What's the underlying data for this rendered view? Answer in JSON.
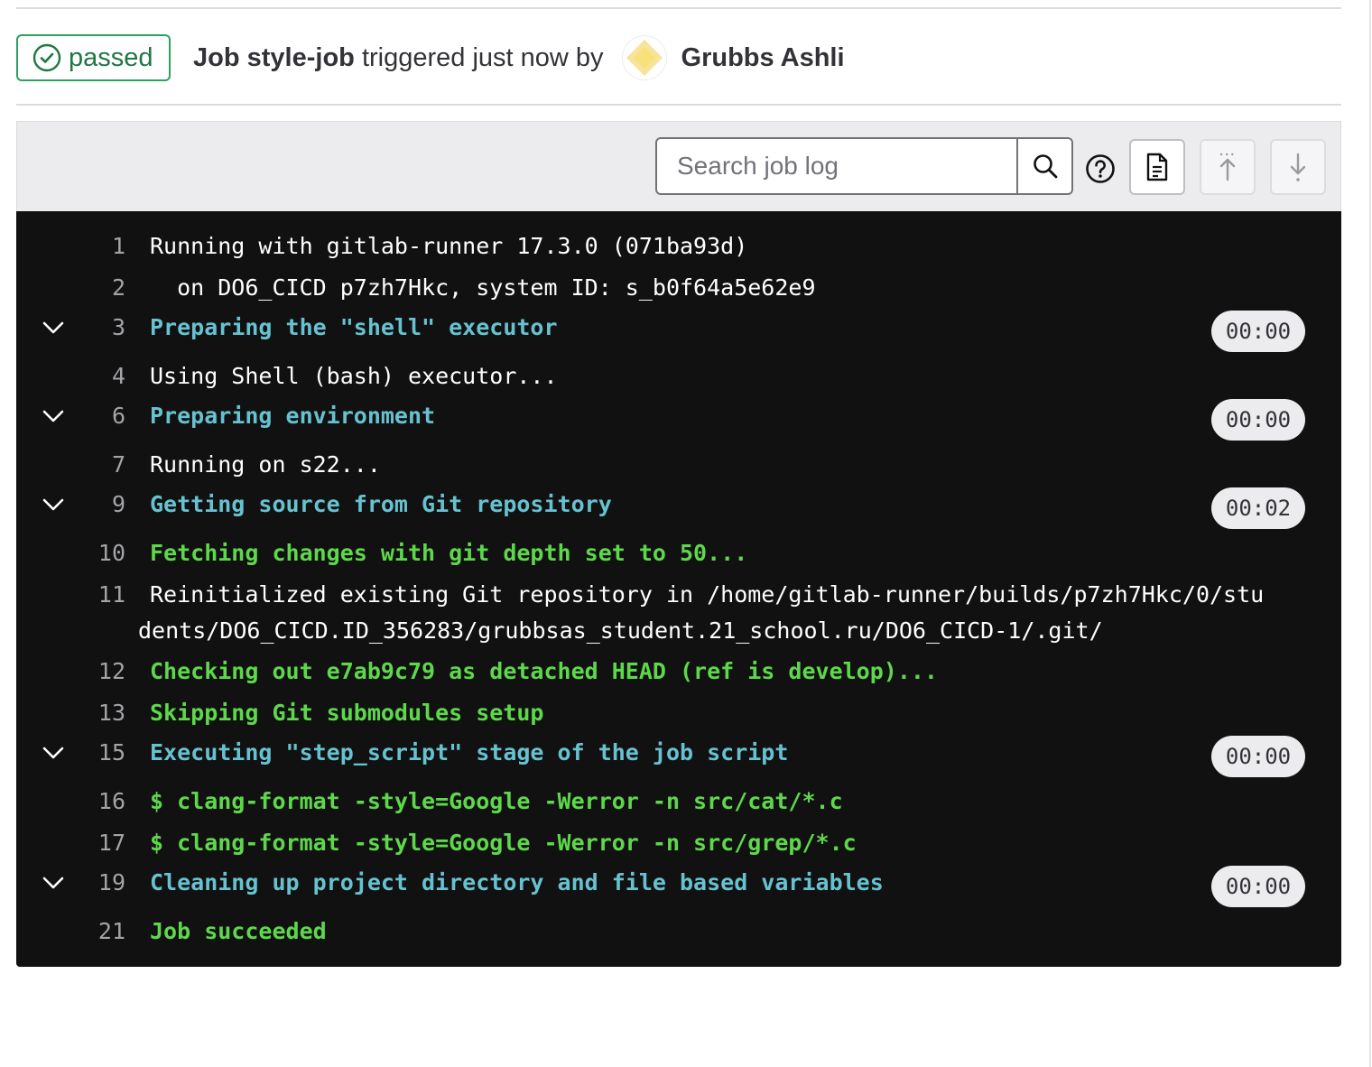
{
  "header": {
    "status": "passed",
    "job_prefix": "Job",
    "job_name": "style-job",
    "trigger_text": "triggered just now by",
    "author": "Grubbs Ashli"
  },
  "toolbar": {
    "search_placeholder": "Search job log",
    "icons": [
      "search-icon",
      "help-icon",
      "raw-log-icon",
      "scroll-top-icon",
      "scroll-bottom-icon"
    ]
  },
  "log": {
    "lines": [
      {
        "num": "1",
        "text": "Running with gitlab-runner 17.3.0 (071ba93d)"
      },
      {
        "num": "2",
        "text": "  on DO6_CICD p7zh7Hkc, system ID: s_b0f64a5e62e9"
      },
      {
        "num": "3",
        "text": "Preparing the \"shell\" executor",
        "duration": "00:00"
      },
      {
        "num": "4",
        "text": "Using Shell (bash) executor..."
      },
      {
        "num": "6",
        "text": "Preparing environment",
        "duration": "00:00"
      },
      {
        "num": "7",
        "text": "Running on s22..."
      },
      {
        "num": "9",
        "text": "Getting source from Git repository",
        "duration": "00:02"
      },
      {
        "num": "10",
        "text": "Fetching changes with git depth set to 50..."
      },
      {
        "num": "11",
        "text": "Reinitialized existing Git repository in /home/gitlab-runner/builds/p7zh7Hkc/0/stu",
        "text2": "dents/DO6_CICD.ID_356283/grubbsas_student.21_school.ru/DO6_CICD-1/.git/"
      },
      {
        "num": "12",
        "text": "Checking out e7ab9c79 as detached HEAD (ref is develop)..."
      },
      {
        "num": "13",
        "text": "Skipping Git submodules setup"
      },
      {
        "num": "15",
        "text": "Executing \"step_script\" stage of the job script",
        "duration": "00:00"
      },
      {
        "num": "16",
        "text": "$ clang-format -style=Google -Werror -n src/cat/*.c"
      },
      {
        "num": "17",
        "text": "$ clang-format -style=Google -Werror -n src/grep/*.c"
      },
      {
        "num": "19",
        "text": "Cleaning up project directory and file based variables",
        "duration": "00:00"
      },
      {
        "num": "21",
        "text": "Job succeeded"
      }
    ]
  }
}
